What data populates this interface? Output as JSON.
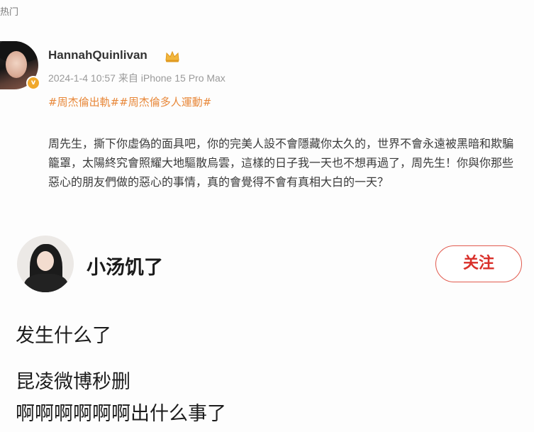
{
  "top_tab": {
    "label": "热门"
  },
  "post1": {
    "username": "HannahQuinlivan",
    "meta": "2024-1-4 10:57 来自 iPhone 15 Pro Max",
    "hashtags": "#周杰倫出軌##周杰倫多人運動#",
    "body": "周先生，撕下你虛偽的面具吧，你的完美人設不會隱藏你太久的，世界不會永遠被黑暗和欺騙籠罩，太陽終究會照耀大地驅散烏雲，這樣的日子我一天也不想再過了，周先生！你與你那些惡心的朋友們做的惡心的事情，真的會覺得不會有真相大白的一天？",
    "icons": {
      "verify": "verified-badge-icon",
      "crown": "crown-icon"
    },
    "colors": {
      "hashtag": "#e8883a",
      "meta": "#9a9a9a"
    }
  },
  "post2": {
    "username": "小汤饥了",
    "follow_label": "关注",
    "comments": [
      "发生什么了",
      "昆凌微博秒删",
      "啊啊啊啊啊啊出什么事了"
    ],
    "colors": {
      "follow": "#d9302a"
    }
  }
}
